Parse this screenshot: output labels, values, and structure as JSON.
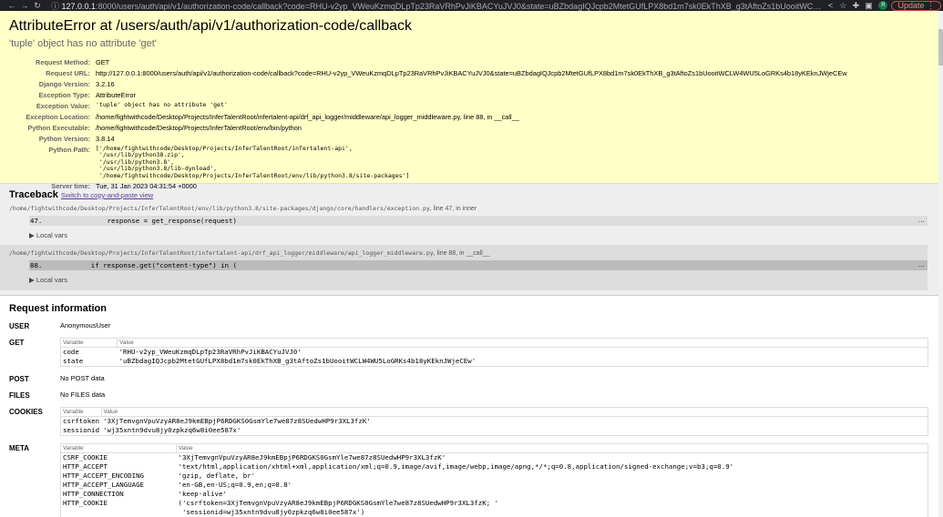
{
  "browser": {
    "url_host": "127.0.0.1",
    "url_rest": ":8000/users/auth/api/v1/authorization-code/callback?code=RHU-v2yp_VWeuKzmqDLpTp23RaVRhPvJiKBACYuJVJ0&state=uBZbdagIQJcpb2MtetGUfLPX8bd1m7sk0EkThXB_g3tAftoZs1bUooitWCLW4WU5LoGRKs4b...",
    "avatar": "R",
    "update_label": "Update"
  },
  "summary": {
    "title": "AttributeError at /users/auth/api/v1/authorization-code/callback",
    "subtitle": "'tuple' object has no attribute 'get'",
    "rows": [
      {
        "label": "Request Method:",
        "value": "GET"
      },
      {
        "label": "Request URL:",
        "value": "http://127.0.0.1:8000/users/auth/api/v1/authorization-code/callback?code=RHU-v2yp_VWeuKzmqDLpTp23RaVRhPvJiKBACYuJVJ0&state=uBZbdagIQJcpb2MtetGUfLPX8bd1m7sk0EkThXB_g3tAftoZs1bUooitWCLW4WU5LoGRKs4b18yKEknJWjeCEw"
      },
      {
        "label": "Django Version:",
        "value": "3.2.16"
      },
      {
        "label": "Exception Type:",
        "value": "AttributeError"
      },
      {
        "label": "Exception Value:",
        "value": "'tuple' object has no attribute 'get'"
      },
      {
        "label": "Exception Location:",
        "value": "/home/fightwithcode/Desktop/Projects/InferTalentRoot/infertalent-api/drf_api_logger/middleware/api_logger_middleware.py, line 88, in __call__"
      },
      {
        "label": "Python Executable:",
        "value": "/home/fightwithcode/Desktop/Projects/InferTalentRoot/env/bin/python"
      },
      {
        "label": "Python Version:",
        "value": "3.8.14"
      },
      {
        "label": "Python Path:",
        "value": "['/home/fightwithcode/Desktop/Projects/InferTalentRoot/infertalent-api',\n '/usr/lib/python38.zip',\n '/usr/lib/python3.8',\n '/usr/lib/python3.8/lib-dynload',\n '/home/fightwithcode/Desktop/Projects/InferTalentRoot/env/lib/python3.8/site-packages']"
      },
      {
        "label": "Server time:",
        "value": "Tue, 31 Jan 2023 04:31:54 +0000"
      }
    ]
  },
  "traceback": {
    "title": "Traceback",
    "switch_link": "Switch to copy-and-paste view",
    "frames": [
      {
        "file": "/home/fightwithcode/Desktop/Projects/InferTalentRoot/env/lib/python3.8/site-packages/django/core/handlers/exception.py",
        "loc": ", line 47, in inner",
        "lineno": "47.",
        "code": "                response = get_response(request)",
        "local_vars": "▶ Local vars"
      },
      {
        "file": "/home/fightwithcode/Desktop/Projects/InferTalentRoot/infertalent-api/drf_api_logger/middleware/api_logger_middleware.py",
        "loc": ", line 88, in __call__",
        "lineno": "88.",
        "code": "            if response.get(\"content-type\") in (",
        "local_vars": "▶ Local vars"
      }
    ],
    "ellipsis": "…"
  },
  "request": {
    "title": "Request information",
    "user": {
      "label": "USER",
      "value": "AnonymousUser"
    },
    "get": {
      "label": "GET",
      "headers": [
        "Variable",
        "Value"
      ],
      "rows": [
        [
          "code",
          "'RHU-v2yp_VWeuKzmqDLpTp23RaVRhPvJiKBACYuJVJ0'"
        ],
        [
          "state",
          "'uBZbdagIQJcpb2MtetGUfLPX8bd1m7sk0EkThXB_g3tAftoZs1bUooitWCLW4WU5LoGRKs4b18yKEknJWjeCEw'"
        ]
      ]
    },
    "post": {
      "label": "POST",
      "value": "No POST data"
    },
    "files": {
      "label": "FILES",
      "value": "No FILES data"
    },
    "cookies": {
      "label": "COOKIES",
      "headers": [
        "Variable",
        "Value"
      ],
      "rows": [
        [
          "csrftoken",
          "'3XjTemvgnVpuVzyAR8eJ9kmEBpjP6RDGKS0GsmYle7we87z8SUedwHP9r3XL3fzK'"
        ],
        [
          "sessionid",
          "'wj35xntn9dvu8jy0zpkzq6w8i0ee587x'"
        ]
      ]
    },
    "meta": {
      "label": "META",
      "headers": [
        "Variable",
        "Value"
      ],
      "rows": [
        [
          "CSRF_COOKIE",
          "'3XjTemvgnVpuVzyAR8eJ9kmEBpjP6RDGKS0GsmYle7we87z8SUedwHP9r3XL3fzK'"
        ],
        [
          "HTTP_ACCEPT",
          "'text/html,application/xhtml+xml,application/xml;q=0.9,image/avif,image/webp,image/apng,*/*;q=0.8,application/signed-exchange;v=b3;q=0.9'"
        ],
        [
          "HTTP_ACCEPT_ENCODING",
          "'gzip, deflate, br'"
        ],
        [
          "HTTP_ACCEPT_LANGUAGE",
          "'en-GB,en-US;q=0.9,en;q=0.8'"
        ],
        [
          "HTTP_CONNECTION",
          "'keep-alive'"
        ],
        [
          "HTTP_COOKIE",
          "('csrftoken=3XjTemvgnVpuVzyAR8eJ9kmEBpjP6RDGKS0GsmYle7we87z8SUedwHP9r3XL3fzK; '\n 'sessionid=wj35xntn9dvu8jy0zpkzq6w8i0ee587x')"
        ]
      ]
    }
  }
}
